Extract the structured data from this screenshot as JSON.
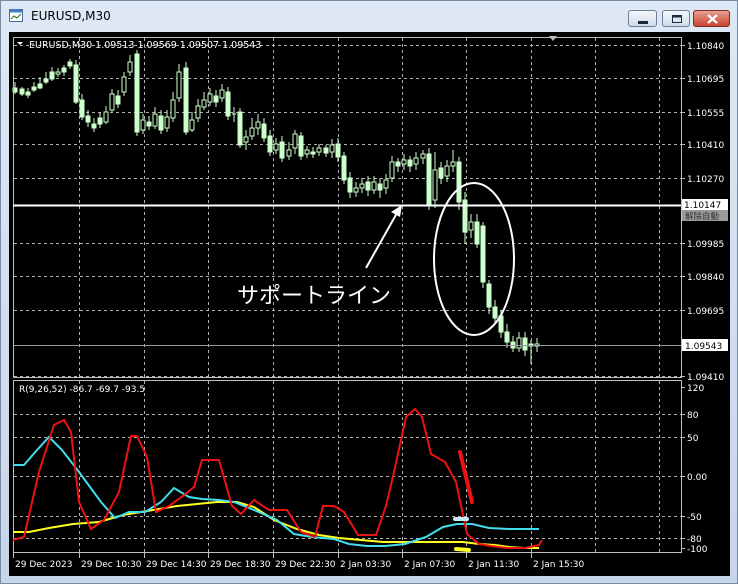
{
  "window": {
    "title": "EURUSD,M30"
  },
  "main_panel": {
    "header": "EURUSD,M30  1.09513 1.09569 1.09507 1.09543",
    "price_labels": [
      "1.10840",
      "1.10695",
      "1.10555",
      "1.10410",
      "1.10270",
      "1.10147",
      "1.09985",
      "1.09840",
      "1.09695",
      "1.09543",
      "1.09410"
    ],
    "tag_label": "1.10147",
    "tag_sub_label": "解除自動",
    "bid_label": "1.09543"
  },
  "annotations": {
    "support_text": "サポートライン"
  },
  "indicator_panel": {
    "header": "R(9,26,52) -86.7 -69.7 -93.5",
    "scale_labels": [
      "120",
      "80",
      "50",
      "0.00",
      "-50",
      "-80",
      "-100"
    ]
  },
  "time_axis": {
    "labels": [
      "29 Dec 2023",
      "29 Dec 10:30",
      "29 Dec 14:30",
      "29 Dec 18:30",
      "29 Dec 22:30",
      "2 Jan 03:30",
      "2 Jan 07:30",
      "2 Jan 11:30",
      "2 Jan 15:30"
    ]
  },
  "colors": {
    "background": "#000000",
    "grid": "#c0c0c0",
    "candle": "#ccffcc",
    "support_line": "#ffffff",
    "red_line": "#ee1111",
    "cyan_line": "#44ddee",
    "yellow_line": "#ffff22"
  }
}
